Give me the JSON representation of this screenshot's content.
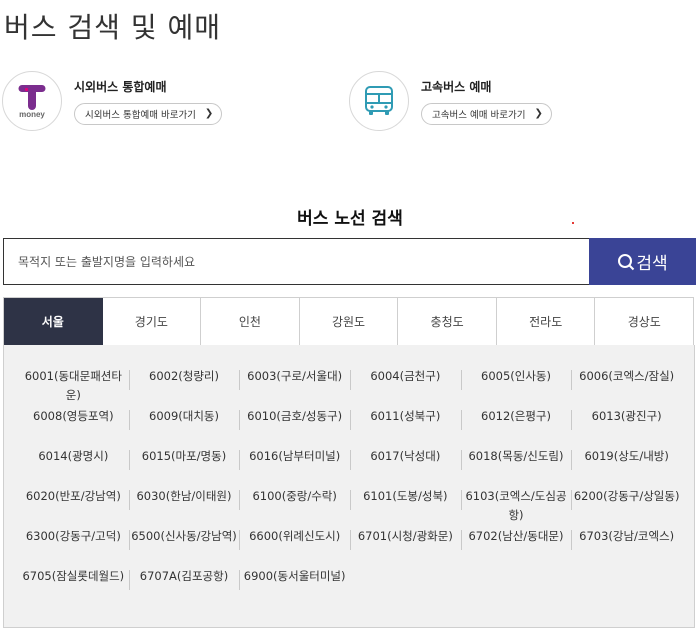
{
  "page": {
    "title": "버스 검색 및 예매"
  },
  "services": [
    {
      "logo_text": "money",
      "title": "시외버스 통합예매",
      "link": "시외버스 통합예매 바로가기"
    },
    {
      "title": "고속버스 예매",
      "link": "고속버스 예매 바로가기"
    }
  ],
  "route_search": {
    "title": "버스 노선 검색",
    "placeholder": "목적지 또는 출발지명을 입력하세요",
    "button_label": "검색"
  },
  "regions": [
    "서울",
    "경기도",
    "인천",
    "강원도",
    "충청도",
    "전라도",
    "경상도"
  ],
  "active_region": "서울",
  "routes": [
    "6001(동대문패션타운)",
    "6002(청량리)",
    "6003(구로/서울대)",
    "6004(금천구)",
    "6005(인사동)",
    "6006(코엑스/잠실)",
    "6008(영등포역)",
    "6009(대치동)",
    "6010(금호/성동구)",
    "6011(성북구)",
    "6012(은평구)",
    "6013(광진구)",
    "6014(광명시)",
    "6015(마포/명동)",
    "6016(남부터미널)",
    "6017(낙성대)",
    "6018(목동/신도림)",
    "6019(상도/내방)",
    "6020(반포/강남역)",
    "6030(한남/이태원)",
    "6100(중랑/수락)",
    "6101(도봉/성북)",
    "6103(코엑스/도심공항)",
    "6200(강동구/상일동)",
    "6300(강동구/고덕)",
    "6500(신사동/강남역)",
    "6600(위례신도시)",
    "6701(시청/광화문)",
    "6702(남산/동대문)",
    "6703(강남/코엑스)",
    "6705(잠실롯데월드)",
    "6707A(김포공항)",
    "6900(동서울터미널)"
  ],
  "colors": {
    "accent": "#3a4496",
    "tab_active": "#2e3346",
    "tmoney_purple": "#7b2d8e"
  }
}
